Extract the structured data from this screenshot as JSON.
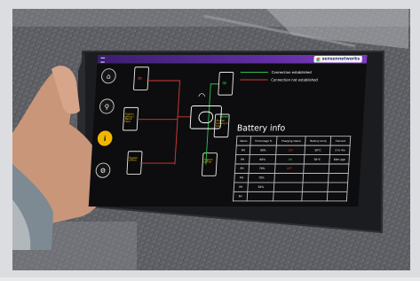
{
  "screen": {
    "brand": "sensennetworks",
    "legend": {
      "connected": "Connection established",
      "not_connected": "Connection not established",
      "connected_color": "#2fc04a",
      "not_connected_color": "#d63a3a"
    },
    "battery_title": "Battery info",
    "battery_table": {
      "headers": [
        "Name",
        "Percentage %",
        "Charging status",
        "Battery temp",
        "Connect"
      ],
      "rows": [
        [
          "PH",
          "90%",
          "OFF",
          "30°C",
          "3 hr 4m"
        ],
        [
          "PH",
          "60%",
          "ON",
          "30°C",
          "60m ago"
        ],
        [
          "PH",
          "70%",
          "OFF",
          "",
          ""
        ],
        [
          "PH",
          "70%",
          "",
          "",
          ""
        ],
        [
          "PH",
          "50%",
          "",
          "",
          ""
        ],
        [
          "PH",
          "",
          "",
          "",
          ""
        ]
      ]
    },
    "phones": [
      {
        "status": "red",
        "label": ""
      },
      {
        "status": "none",
        "label": "Station offline / Name Here"
      },
      {
        "status": "none",
        "label": "Station offline"
      },
      {
        "status": "green",
        "label": ""
      },
      {
        "status": "none",
        "label": "Station battery is low"
      },
      {
        "status": "none",
        "label": "Station offline"
      }
    ]
  }
}
